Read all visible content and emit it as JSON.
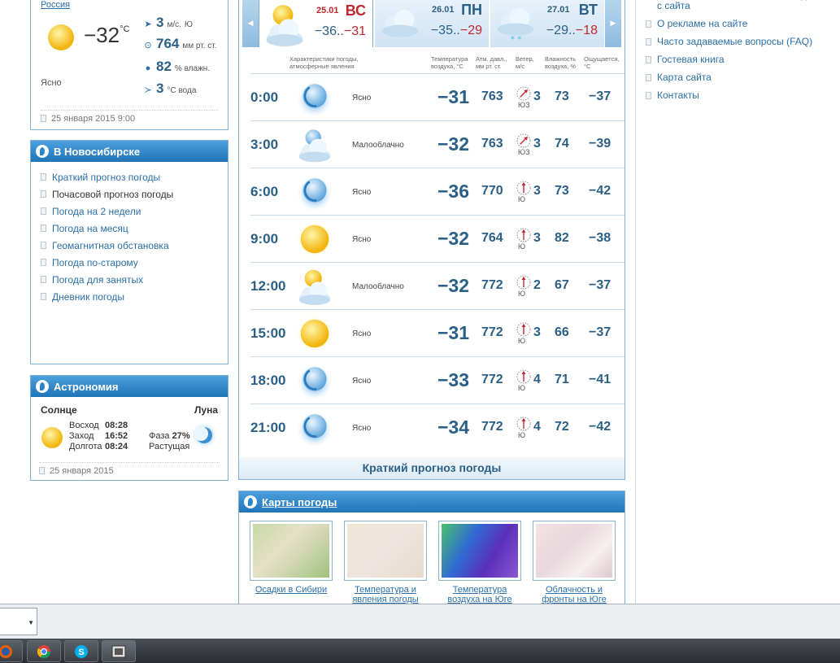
{
  "location": {
    "country": "Россия",
    "current_temp": "−32",
    "temp_unit": "°C",
    "condition": "Ясно",
    "wind_value": "3",
    "wind_unit": "м/с.",
    "wind_dir": "Ю",
    "pressure_value": "764",
    "pressure_unit": "мм рт. ст.",
    "humidity_value": "82",
    "humidity_unit": "% влажн.",
    "water_value": "3",
    "water_unit": "°С вода",
    "date": "25 января 2015 9:00"
  },
  "city_nav": {
    "title": "В Новосибирске",
    "items": [
      "Краткий прогноз погоды",
      "Почасовой прогноз погоды",
      "Погода на 2 недели",
      "Погода на месяц",
      "Геомагнитная обстановка",
      "Погода по-старому",
      "Погода для занятых",
      "Дневник погоды"
    ]
  },
  "astronomy": {
    "title": "Астрономия",
    "sun_label": "Солнце",
    "moon_label": "Луна",
    "sunrise_label": "Восход",
    "sunrise": "08:28",
    "sunset_label": "Заход",
    "sunset": "16:52",
    "daylength_label": "Долгота",
    "daylength": "08:24",
    "phase_label": "Фаза",
    "phase": "27%",
    "phase_state": "Растущая",
    "date": "25 января 2015"
  },
  "day_tabs": [
    {
      "date": "25.01",
      "weekday": "ВС",
      "low": "−36",
      "high": "−31"
    },
    {
      "date": "26.01",
      "weekday": "ПН",
      "low": "−35",
      "high": "−29"
    },
    {
      "date": "27.01",
      "weekday": "ВТ",
      "low": "−29",
      "high": "−18"
    }
  ],
  "columns": {
    "conditions": "Характеристики погоды, атмосферные явления",
    "temp": "Температура воздуха, °С",
    "pressure": "Атм. давл., мм рт. ст.",
    "wind": "Ветер, м/с",
    "humidity": "Влажность воздуха, %",
    "feels": "Ощущается, °С"
  },
  "hourly": [
    {
      "time": "0:00",
      "icon": "moon-icon",
      "cond": "Ясно",
      "temp": "−31",
      "pres": "763",
      "wind": "3",
      "wdir": "ЮЗ",
      "hum": "73",
      "feel": "−37"
    },
    {
      "time": "3:00",
      "icon": "cloudy-moon-icon",
      "cond": "Малооблачно",
      "temp": "−32",
      "pres": "763",
      "wind": "3",
      "wdir": "ЮЗ",
      "hum": "74",
      "feel": "−39"
    },
    {
      "time": "6:00",
      "icon": "moon-icon",
      "cond": "Ясно",
      "temp": "−36",
      "pres": "770",
      "wind": "3",
      "wdir": "Ю",
      "hum": "73",
      "feel": "−42"
    },
    {
      "time": "9:00",
      "icon": "sun-icon",
      "cond": "Ясно",
      "temp": "−32",
      "pres": "764",
      "wind": "3",
      "wdir": "Ю",
      "hum": "82",
      "feel": "−38"
    },
    {
      "time": "12:00",
      "icon": "partly-cloudy-icon",
      "cond": "Малооблачно",
      "temp": "−32",
      "pres": "772",
      "wind": "2",
      "wdir": "Ю",
      "hum": "67",
      "feel": "−37"
    },
    {
      "time": "15:00",
      "icon": "sun-icon",
      "cond": "Ясно",
      "temp": "−31",
      "pres": "772",
      "wind": "3",
      "wdir": "Ю",
      "hum": "66",
      "feel": "−37"
    },
    {
      "time": "18:00",
      "icon": "moon-icon",
      "cond": "Ясно",
      "temp": "−33",
      "pres": "772",
      "wind": "4",
      "wdir": "Ю",
      "hum": "71",
      "feel": "−41"
    },
    {
      "time": "21:00",
      "icon": "moon-icon",
      "cond": "Ясно",
      "temp": "−34",
      "pres": "772",
      "wind": "4",
      "wdir": "Ю",
      "hum": "72",
      "feel": "−42"
    }
  ],
  "brief_link": "Краткий прогноз погоды",
  "maps": {
    "title": "Карты погоды",
    "items": [
      {
        "caption": "Осадки в Сибири"
      },
      {
        "caption": "Температура и явления погоды"
      },
      {
        "caption": "Температура воздуха на Юге"
      },
      {
        "caption": "Облачность и фронты на Юге"
      }
    ]
  },
  "right_links": [
    "Соглашение об использовании данных с сайта",
    "О рекламе на сайте",
    "Часто задаваемые вопросы (FAQ)",
    "Гостевая книга",
    "Карта сайта",
    "Контакты"
  ],
  "colors": {
    "accent": "#1f74b8",
    "text_blue": "#2a5f86",
    "warm": "#c0272d"
  }
}
